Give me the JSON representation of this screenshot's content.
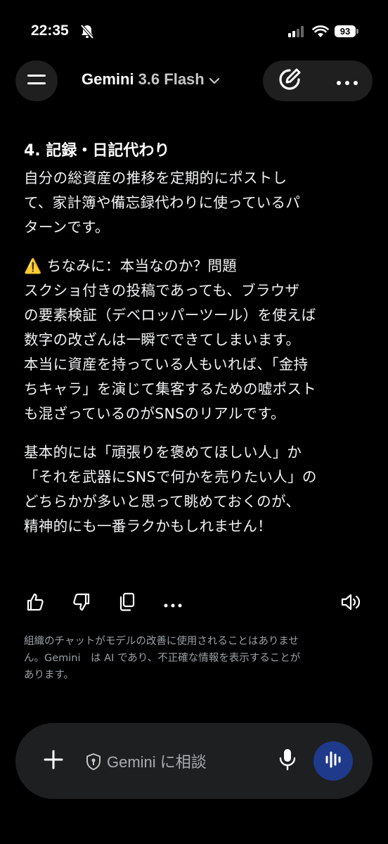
{
  "status_bar": {
    "time": "22:35",
    "battery": "93"
  },
  "header": {
    "model_name": "Gemini",
    "model_version": "3.6 Flash"
  },
  "response": {
    "heading": "4. 記録・日記代わり",
    "para1_lines": [
      "自分の総資産の推移を定期的にポストし",
      "て、家計簿や備忘録代わりに使っているパ",
      "ターンです。"
    ],
    "warning_emoji": "⚠️",
    "warning_title": " ちなみに：本当なのか？問題",
    "para2_lines": [
      "スクショ付きの投稿であっても、ブラウザ",
      "の要素検証（デベロッパーツール）を使えば",
      "数字の改ざんは一瞬でできてしまいます。",
      "本当に資産を持っている人もいれば、「金持",
      "ちキャラ」を演じて集客するための嘘ポスト",
      "も混ざっているのがSNSのリアルです。"
    ],
    "para3_lines": [
      "基本的には「頑張りを褒めてほしい人」か",
      "「それを武器にSNSで何かを売りたい人」の",
      "どちらかが多いと思って眺めておくのが、",
      "精神的にも一番ラクかもしれません！"
    ]
  },
  "disclaimer_lines": [
    "組織のチャットがモデルの改善に使用されることはありませ",
    "ん。Gemini　は AI であり、不正確な情報を表示することが",
    "あります。"
  ],
  "input": {
    "placeholder": "Gemini に相談"
  },
  "icons": [
    "menu-icon",
    "chevron-down-icon",
    "new-chat-icon",
    "more-icon",
    "thumbs-up-icon",
    "thumbs-down-icon",
    "copy-icon",
    "more-options-icon",
    "speaker-icon",
    "plus-icon",
    "shield-icon",
    "mic-icon",
    "live-icon"
  ],
  "colors": {
    "background": "#000000",
    "surface": "#1f1f1f",
    "live_button": "#1f3a8a",
    "muted_text": "#9aa0a6"
  }
}
